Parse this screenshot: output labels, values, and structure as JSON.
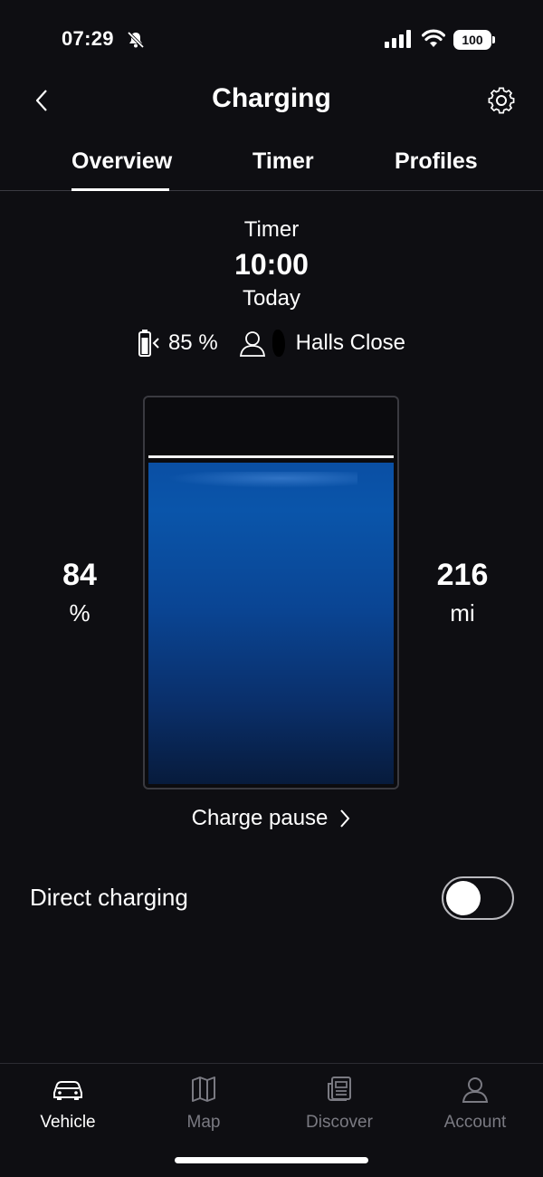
{
  "status_bar": {
    "time": "07:29",
    "battery_level": "100",
    "icons": [
      "bell-slash-icon",
      "signal-icon",
      "wifi-icon",
      "battery-icon"
    ]
  },
  "header": {
    "title": "Charging",
    "back_icon": "chevron-left-icon",
    "settings_icon": "gear-icon"
  },
  "tabs": [
    {
      "label": "Overview",
      "active": true
    },
    {
      "label": "Timer",
      "active": false
    },
    {
      "label": "Profiles",
      "active": false
    }
  ],
  "timer": {
    "label": "Timer",
    "time": "10:00",
    "day": "Today"
  },
  "target": {
    "charge_target": "85 %",
    "profile_location": "Halls Close"
  },
  "battery": {
    "current_percent": "84",
    "percent_unit": "%",
    "range": "216",
    "range_unit": "mi",
    "fill_fraction": 0.84,
    "target_fraction": 0.85,
    "fill_color": "#0a4fa4"
  },
  "charge_pause": {
    "label": "Charge pause"
  },
  "direct_charging": {
    "label": "Direct charging",
    "enabled": false
  },
  "bottom_nav": [
    {
      "label": "Vehicle",
      "icon": "car-icon",
      "active": true
    },
    {
      "label": "Map",
      "icon": "map-icon",
      "active": false
    },
    {
      "label": "Discover",
      "icon": "news-icon",
      "active": false
    },
    {
      "label": "Account",
      "icon": "person-icon",
      "active": false
    }
  ]
}
